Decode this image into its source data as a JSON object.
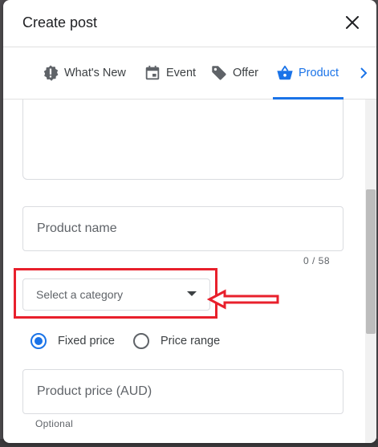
{
  "dialog": {
    "title": "Create post",
    "tabs": [
      {
        "label": "What's New",
        "icon": "alert-badge-icon"
      },
      {
        "label": "Event",
        "icon": "calendar-icon"
      },
      {
        "label": "Offer",
        "icon": "tag-icon"
      },
      {
        "label": "Product",
        "icon": "basket-icon",
        "active": true
      }
    ]
  },
  "form": {
    "product_name_placeholder": "Product name",
    "char_counter": "0 / 58",
    "category_placeholder": "Select a category",
    "price_type": {
      "options": [
        "Fixed price",
        "Price range"
      ],
      "selected": "Fixed price"
    },
    "price_placeholder": "Product price (AUD)",
    "price_helper": "Optional"
  },
  "colors": {
    "accent": "#1a73e8",
    "annotation": "#e8202c"
  }
}
